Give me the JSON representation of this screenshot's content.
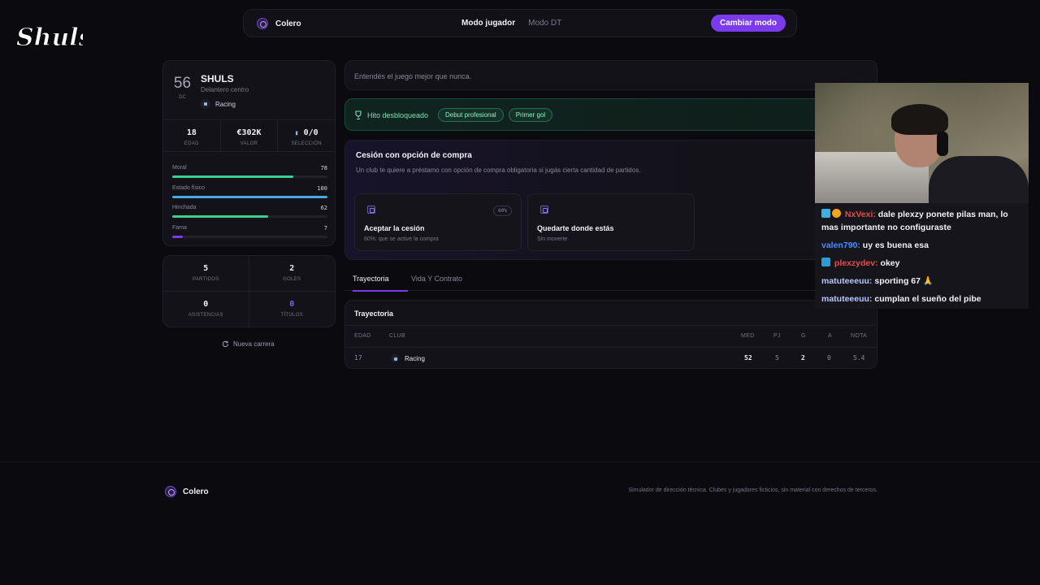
{
  "logo": {
    "text": "Shuls"
  },
  "topbar": {
    "brand": "Colero",
    "mode_player": "Modo jugador",
    "mode_dt": "Modo DT",
    "switch_label": "Cambiar modo"
  },
  "player": {
    "rating": "56",
    "position": "DC",
    "name": "SHULS",
    "role": "Delantero centro",
    "club": "Racing",
    "stats": [
      {
        "value": "18",
        "label": "EDAD"
      },
      {
        "value": "€302K",
        "label": "VALOR"
      },
      {
        "value": "0/0",
        "label": "SELECCIÓN"
      }
    ],
    "bars": [
      {
        "label": "Moral",
        "value": 78,
        "color": "#3ecf8e"
      },
      {
        "label": "Estado físico",
        "value": 100,
        "color": "#4aa8e0"
      },
      {
        "label": "Hinchada",
        "value": 62,
        "color": "#3ecf8e"
      },
      {
        "label": "Fama",
        "value": 7,
        "color": "#7c3aed"
      }
    ]
  },
  "career_stats": [
    {
      "value": "5",
      "label": "PARTIDOS"
    },
    {
      "value": "2",
      "label": "GOLES"
    },
    {
      "value": "0",
      "label": "ASISTENCIAS"
    },
    {
      "value": "0",
      "label": "TÍTULOS",
      "accent": "#8b5cf6"
    }
  ],
  "new_career": "Nueva carrera",
  "quote": "Entendés el juego mejor que nunca.",
  "milestone": {
    "label": "Hito desbloqueado",
    "tags": [
      "Debut profesional",
      "Primer gol"
    ]
  },
  "loan": {
    "title": "Cesión con opción de compra",
    "subtitle": "Un club te quiere a préstamo con opción de compra obligatoria si jugás cierta cantidad de partidos.",
    "options": [
      {
        "title": "Aceptar la cesión",
        "subtitle": "60%: que se active la compra",
        "badge": "60%"
      },
      {
        "title": "Quedarte donde estás",
        "subtitle": "Sin moverte"
      }
    ]
  },
  "tabs": [
    "Trayectoria",
    "Vida Y Contrato"
  ],
  "trajectory": {
    "title": "Trayectoria",
    "headers": [
      "EDAD",
      "CLUB",
      "MED",
      "PJ",
      "G",
      "A",
      "NOTA"
    ],
    "rows": [
      {
        "edad": "17",
        "club": "Racing",
        "med": "52",
        "pj": "5",
        "g": "2",
        "a": "0",
        "nota": "5.4"
      }
    ]
  },
  "footer": {
    "brand": "Colero",
    "note": "Simulador de dirección técnica. Clubes y jugadores ficticios, sin material con derechos de terceros."
  },
  "chat": [
    {
      "user": "NxVexi:",
      "text": "dale plexzy ponete pilas man, lo mas importante no configuraste",
      "color": "#e84a4a"
    },
    {
      "user": "valen790:",
      "text": "uy es buena esa",
      "color": "#4a8cff"
    },
    {
      "user": "plexzydev:",
      "text": "okey",
      "color": "#e84a4a"
    },
    {
      "user": "matuteeeuu:",
      "text": "sporting 67 🙏",
      "color": "#b8c6ff"
    },
    {
      "user": "matuteeeuu:",
      "text": "cumplan el sueño del pibe",
      "color": "#b8c6ff"
    }
  ]
}
